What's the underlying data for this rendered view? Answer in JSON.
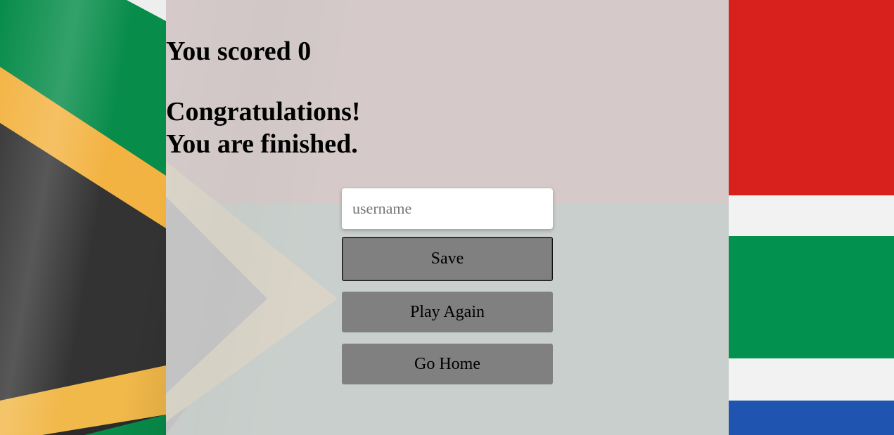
{
  "result": {
    "score_text": "You scored 0",
    "congrats_line1": "Congratulations!",
    "congrats_line2": "You are finished."
  },
  "form": {
    "username_placeholder": "username",
    "username_value": ""
  },
  "buttons": {
    "save_label": "Save",
    "play_again_label": "Play Again",
    "go_home_label": "Go Home"
  },
  "background": {
    "theme": "south-africa-flag",
    "colors": {
      "green": "#007a4d",
      "gold": "#ffb612",
      "black": "#000000",
      "red": "#de3831",
      "blue": "#002395",
      "white": "#ffffff",
      "button_gray": "#808080"
    }
  }
}
